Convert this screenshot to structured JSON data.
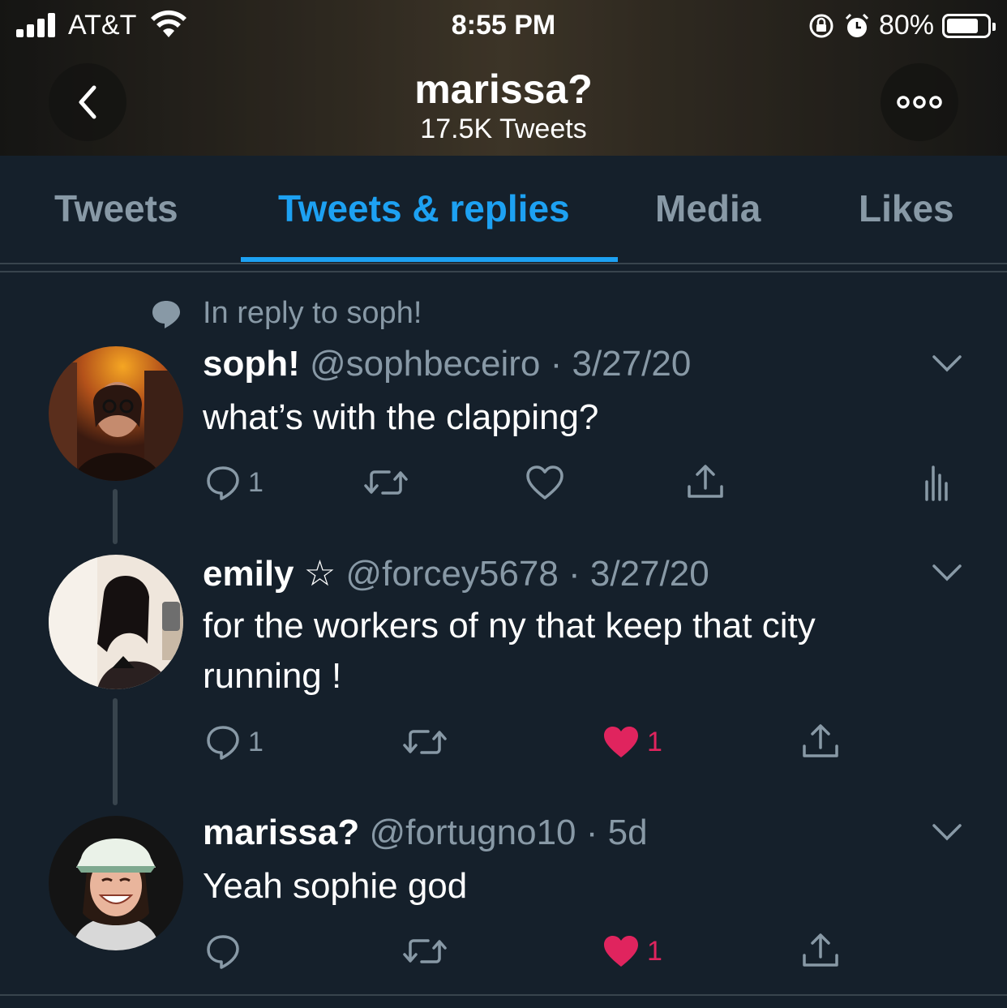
{
  "status_bar": {
    "carrier": "AT&T",
    "time": "8:55 PM",
    "battery": "80%",
    "battery_level": 0.8
  },
  "header": {
    "title": "marissa?",
    "subtitle": "17.5K Tweets"
  },
  "tabs": [
    {
      "label": "Tweets"
    },
    {
      "label": "Tweets & replies",
      "active": true
    },
    {
      "label": "Media"
    },
    {
      "label": "Likes"
    }
  ],
  "context": "In reply to soph!",
  "tweets": [
    {
      "name": "soph!",
      "meta": "@sophbeceiro · 3/27/20",
      "text": "what’s with the clapping?",
      "reply_count": "1",
      "like_count": ""
    },
    {
      "name": "emily ☆",
      "meta": "@forcey5678 · 3/27/20",
      "text": "for the workers of ny that keep that city running !",
      "reply_count": "1",
      "like_count": "1"
    },
    {
      "name": "marissa?",
      "meta": "@fortugno10 · 5d",
      "text": "Yeah sophie god",
      "reply_count": "",
      "like_count": "1"
    }
  ],
  "colors": {
    "background": "#15202b",
    "accent": "#1da1f2",
    "muted": "#8899a6",
    "like": "#e0245e"
  }
}
